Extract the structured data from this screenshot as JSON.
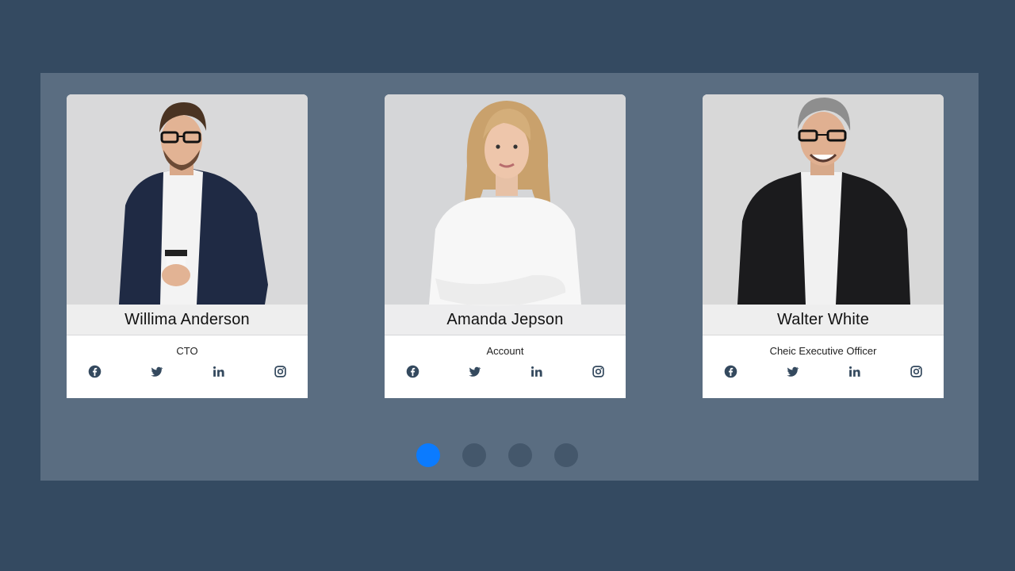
{
  "colors": {
    "page_background": "#344a61",
    "panel_background": "#5a6d81",
    "dot_active": "#0b7bff",
    "dot_inactive": "#44576b",
    "icon_color": "#34495e"
  },
  "cards": [
    {
      "name": "Willima Anderson",
      "role": "CTO",
      "socials": [
        "facebook-icon",
        "twitter-icon",
        "linkedin-icon",
        "instagram-icon"
      ]
    },
    {
      "name": "Amanda Jepson",
      "role": "Account",
      "socials": [
        "facebook-icon",
        "twitter-icon",
        "linkedin-icon",
        "instagram-icon"
      ]
    },
    {
      "name": "Walter White",
      "role": "Cheic Executive Officer",
      "socials": [
        "facebook-icon",
        "twitter-icon",
        "linkedin-icon",
        "instagram-icon"
      ]
    }
  ],
  "pagination": {
    "count": 4,
    "active_index": 0
  }
}
